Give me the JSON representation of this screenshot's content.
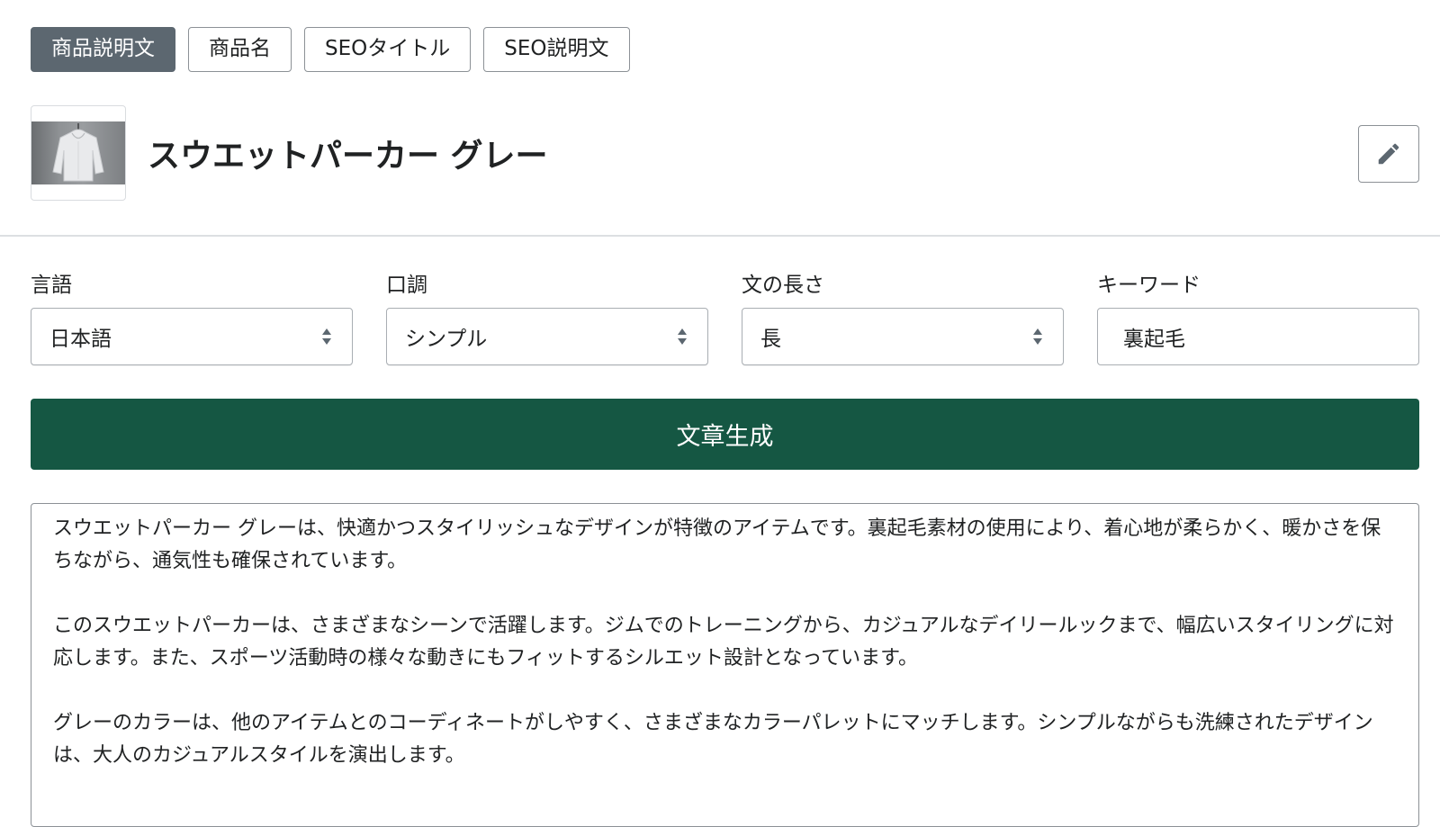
{
  "tabs": [
    {
      "label": "商品説明文",
      "active": true
    },
    {
      "label": "商品名",
      "active": false
    },
    {
      "label": "SEOタイトル",
      "active": false
    },
    {
      "label": "SEO説明文",
      "active": false
    }
  ],
  "product": {
    "name": "スウエットパーカー グレー",
    "thumbnail": "hoodie-photo"
  },
  "edit_button": {
    "icon": "pencil-icon"
  },
  "fields": {
    "language": {
      "label": "言語",
      "value": "日本語"
    },
    "tone": {
      "label": "口調",
      "value": "シンプル"
    },
    "length": {
      "label": "文の長さ",
      "value": "長"
    },
    "keyword": {
      "label": "キーワード",
      "value": "裏起毛"
    }
  },
  "generate_button": {
    "label": "文章生成"
  },
  "output": {
    "paragraphs": [
      "スウエットパーカー グレーは、快適かつスタイリッシュなデザインが特徴のアイテムです。裏起毛素材の使用により、着心地が柔らかく、暖かさを保ちながら、通気性も確保されています。",
      "このスウエットパーカーは、さまざまなシーンで活躍します。ジムでのトレーニングから、カジュアルなデイリールックまで、幅広いスタイリングに対応します。また、スポーツ活動時の様々な動きにもフィットするシルエット設計となっています。",
      "グレーのカラーは、他のアイテムとのコーディネートがしやすく、さまざまなカラーパレットにマッチします。シンプルながらも洗練されたデザインは、大人のカジュアルスタイルを演出します。"
    ]
  },
  "colors": {
    "active_tab": "#5c6770",
    "primary": "#155743",
    "border": "#8c9196"
  }
}
